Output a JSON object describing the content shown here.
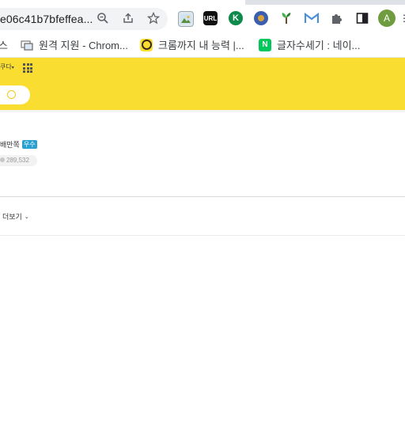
{
  "browser": {
    "url_fragment": "e06c41b7bfeffea...",
    "bookmarks": [
      {
        "label": "스",
        "icon": "bookmark-cut-icon"
      },
      {
        "label": "원격 지원 - Chrom...",
        "icon": "remote-desktop-icon"
      },
      {
        "label": "크롬까지 내 능력 |...",
        "icon": "kakao-icon"
      },
      {
        "label": "글자수세기 : 네이...",
        "icon": "naver-icon"
      }
    ],
    "extensions": [
      "image-extension-icon",
      "url-extension-icon",
      "k-extension-icon",
      "blue-circle-extension-icon",
      "plant-extension-icon",
      "gmail-icon",
      "puzzle-icon",
      "side-panel-icon"
    ],
    "avatar_letter": "A",
    "colors": {
      "page_yellow": "#f9de31",
      "badge_blue": "#2aa0d0",
      "avatar_green": "#6f9c3f"
    }
  },
  "page": {
    "cafe_menu_label": "쿠다",
    "member_grade": "배만쪽",
    "grade_badge": "우수",
    "member_count": "289,532",
    "more_label": "더보기"
  }
}
